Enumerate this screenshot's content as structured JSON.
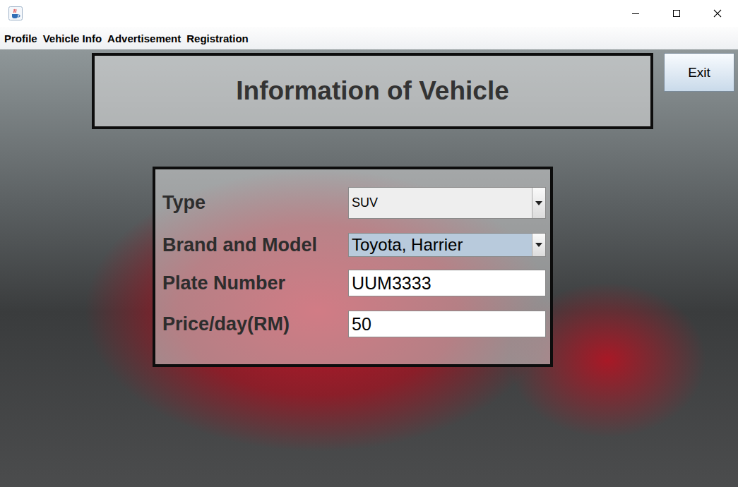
{
  "menu": [
    {
      "label": "Profile"
    },
    {
      "label": "Vehicle Info"
    },
    {
      "label": "Advertisement"
    },
    {
      "label": "Registration"
    }
  ],
  "header": {
    "title": "Information of Vehicle"
  },
  "exit_button": {
    "label": "Exit"
  },
  "form": {
    "fields": [
      {
        "label": "Type",
        "value": "SUV",
        "kind": "combo",
        "focused": false
      },
      {
        "label": "Brand and Model",
        "value": "Toyota, Harrier",
        "kind": "combo",
        "focused": true
      },
      {
        "label": "Plate Number",
        "value": "UUM3333",
        "kind": "text",
        "focused": false
      },
      {
        "label": "Price/day(RM)",
        "value": "50",
        "kind": "text",
        "focused": false
      }
    ]
  }
}
